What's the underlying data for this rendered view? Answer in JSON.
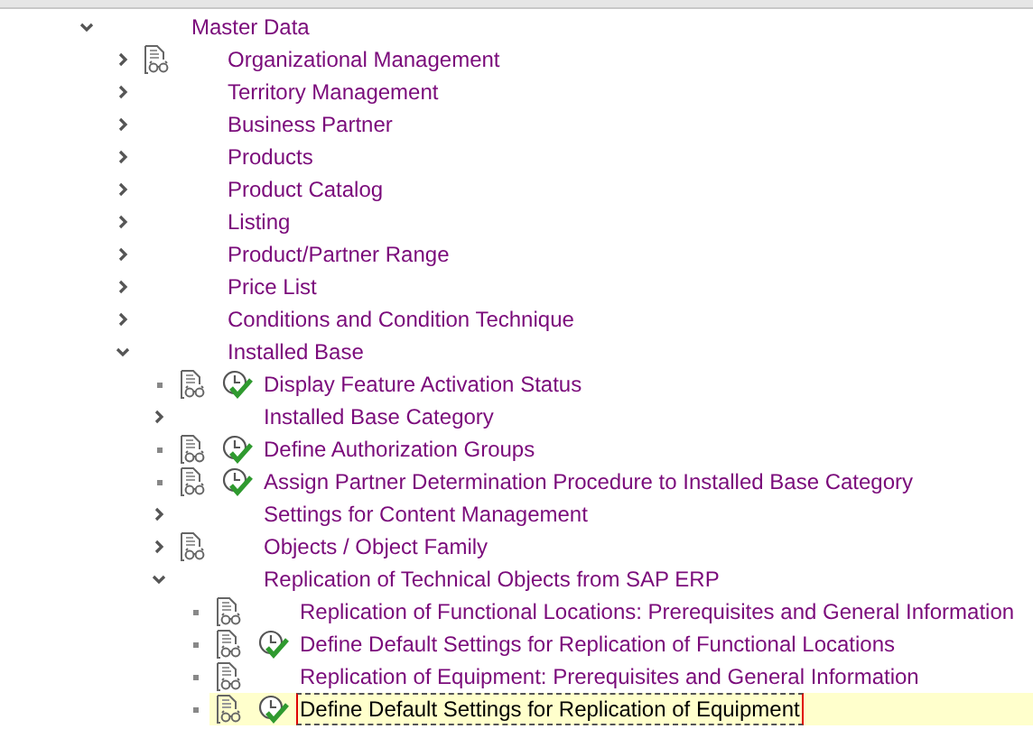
{
  "tree": [
    {
      "label": "Master Data",
      "kind": "folder",
      "expanded": true,
      "documented": false,
      "executable": false,
      "selected": false,
      "children": [
        {
          "label": "Organizational Management",
          "kind": "folder",
          "expanded": false,
          "documented": true,
          "executable": false,
          "selected": false
        },
        {
          "label": "Territory Management",
          "kind": "folder",
          "expanded": false,
          "documented": false,
          "executable": false,
          "selected": false
        },
        {
          "label": "Business Partner",
          "kind": "folder",
          "expanded": false,
          "documented": false,
          "executable": false,
          "selected": false
        },
        {
          "label": "Products",
          "kind": "folder",
          "expanded": false,
          "documented": false,
          "executable": false,
          "selected": false
        },
        {
          "label": "Product Catalog",
          "kind": "folder",
          "expanded": false,
          "documented": false,
          "executable": false,
          "selected": false
        },
        {
          "label": "Listing",
          "kind": "folder",
          "expanded": false,
          "documented": false,
          "executable": false,
          "selected": false
        },
        {
          "label": "Product/Partner Range",
          "kind": "folder",
          "expanded": false,
          "documented": false,
          "executable": false,
          "selected": false
        },
        {
          "label": "Price List",
          "kind": "folder",
          "expanded": false,
          "documented": false,
          "executable": false,
          "selected": false
        },
        {
          "label": "Conditions and Condition Technique",
          "kind": "folder",
          "expanded": false,
          "documented": false,
          "executable": false,
          "selected": false
        },
        {
          "label": "Installed Base",
          "kind": "folder",
          "expanded": true,
          "documented": false,
          "executable": false,
          "selected": false,
          "children": [
            {
              "label": "Display Feature Activation Status",
              "kind": "leaf",
              "documented": true,
              "executable": true,
              "selected": false
            },
            {
              "label": "Installed Base Category",
              "kind": "folder",
              "expanded": false,
              "documented": false,
              "executable": false,
              "selected": false
            },
            {
              "label": "Define Authorization Groups",
              "kind": "leaf",
              "documented": true,
              "executable": true,
              "selected": false
            },
            {
              "label": "Assign Partner Determination Procedure to Installed Base Category",
              "kind": "leaf",
              "documented": true,
              "executable": true,
              "selected": false
            },
            {
              "label": "Settings for Content Management",
              "kind": "folder",
              "expanded": false,
              "documented": false,
              "executable": false,
              "selected": false
            },
            {
              "label": "Objects / Object Family",
              "kind": "folder",
              "expanded": false,
              "documented": true,
              "executable": false,
              "selected": false
            },
            {
              "label": "Replication of Technical Objects from SAP ERP",
              "kind": "folder",
              "expanded": true,
              "documented": false,
              "executable": false,
              "selected": false,
              "children": [
                {
                  "label": "Replication of Functional Locations: Prerequisites and General Information",
                  "kind": "leaf",
                  "documented": true,
                  "executable": false,
                  "selected": false
                },
                {
                  "label": "Define Default Settings for Replication of Functional Locations",
                  "kind": "leaf",
                  "documented": true,
                  "executable": true,
                  "selected": false
                },
                {
                  "label": "Replication of Equipment: Prerequisites and General Information",
                  "kind": "leaf",
                  "documented": true,
                  "executable": false,
                  "selected": false
                },
                {
                  "label": "Define Default Settings for Replication of Equipment",
                  "kind": "leaf",
                  "documented": true,
                  "executable": true,
                  "selected": true
                }
              ]
            }
          ]
        }
      ]
    }
  ]
}
